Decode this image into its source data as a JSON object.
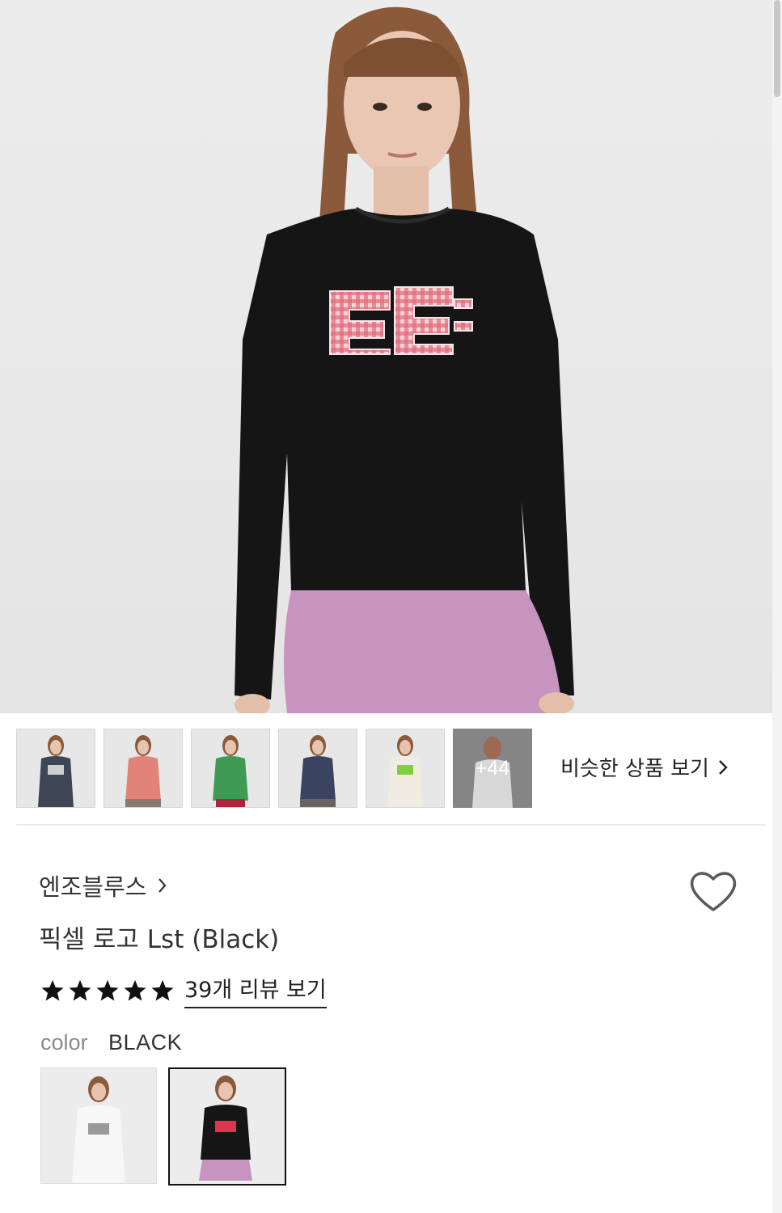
{
  "hero": {
    "alt": "EE pixel logo long sleeve black"
  },
  "gallery": {
    "thumbnails": [
      {
        "name": "thumb-navy-shirt",
        "color": "#3e4656",
        "logo": "#cfcfcf"
      },
      {
        "name": "thumb-coral-shirt",
        "color": "#e2837a",
        "logo": "#e2837a"
      },
      {
        "name": "thumb-green-shirt",
        "color": "#3f9b54",
        "logo": "#3f9b54"
      },
      {
        "name": "thumb-navy-shirt-2",
        "color": "#3a4360",
        "logo": "#3a4360"
      },
      {
        "name": "thumb-cream-shirt",
        "color": "#f0ece2",
        "logo": "#7fd03a"
      }
    ],
    "more_count": "+44",
    "similar_label": "비슷한 상품 보기"
  },
  "product": {
    "brand": "엔조블루스",
    "title": "픽셀 로고 Lst (Black)",
    "rating_stars": 5,
    "review_link": "39개 리뷰 보기",
    "color_label": "color",
    "color_value": "BLACK"
  },
  "colors": {
    "star": "#111111",
    "shirt_black": "#151515",
    "skirt": "#c694bf",
    "logo_red": "#d9374f"
  }
}
